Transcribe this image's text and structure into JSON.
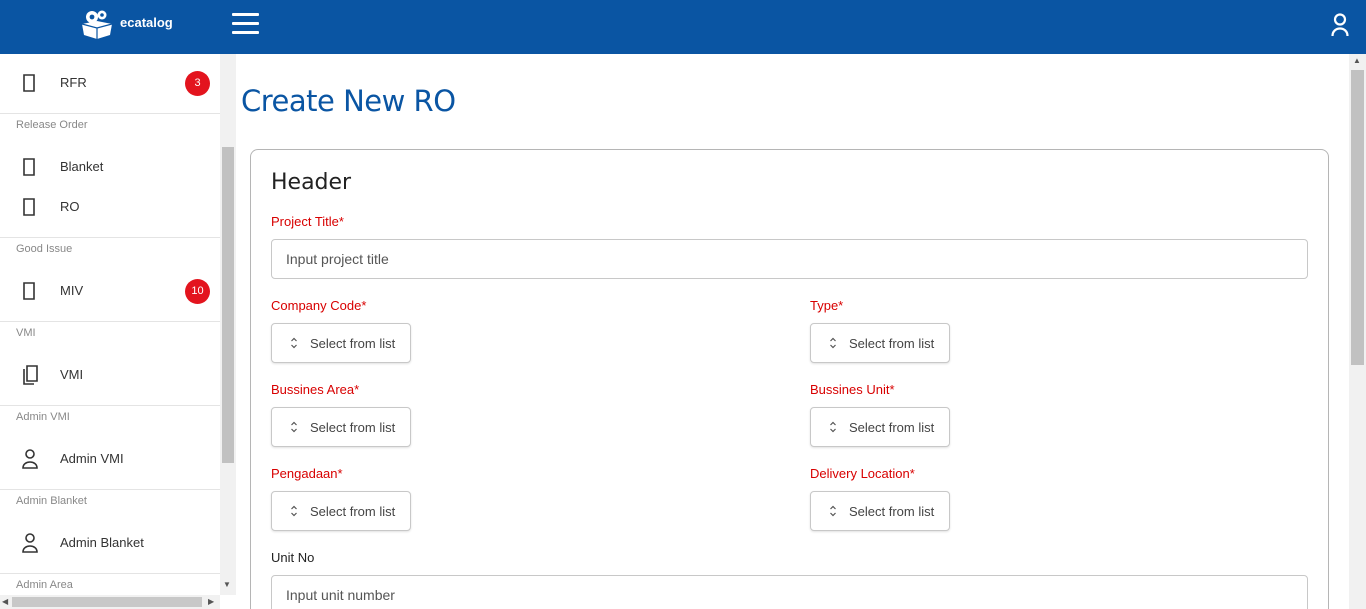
{
  "app": {
    "brand": "ecatalog"
  },
  "colors": {
    "topbar": "#0a55a3",
    "badge": "#e3141e",
    "required_label": "#d80000",
    "title": "#0a55a3"
  },
  "sidebar": {
    "items": [
      {
        "label": "RFR",
        "icon": "document-icon",
        "badge": "3"
      },
      {
        "label": "Blanket",
        "icon": "document-icon"
      },
      {
        "label": "RO",
        "icon": "document-icon"
      },
      {
        "label": "MIV",
        "icon": "document-icon",
        "badge": "10"
      },
      {
        "label": "VMI",
        "icon": "documents-icon"
      },
      {
        "label": "Admin VMI",
        "icon": "person-icon"
      },
      {
        "label": "Admin Blanket",
        "icon": "person-icon"
      }
    ],
    "sections": [
      "Release Order",
      "Good Issue",
      "VMI",
      "Admin VMI",
      "Admin Blanket",
      "Admin Area"
    ]
  },
  "page": {
    "title": "Create New RO"
  },
  "form": {
    "header_title": "Header",
    "project_title": {
      "label": "Project Title*",
      "placeholder": "Input project title"
    },
    "company_code": {
      "label": "Company Code*",
      "value": "Select from list"
    },
    "type": {
      "label": "Type*",
      "value": "Select from list"
    },
    "bussines_area": {
      "label": "Bussines Area*",
      "value": "Select from list"
    },
    "bussines_unit": {
      "label": "Bussines Unit*",
      "value": "Select from list"
    },
    "pengadaan": {
      "label": "Pengadaan*",
      "value": "Select from list"
    },
    "delivery_location": {
      "label": "Delivery Location*",
      "value": "Select from list"
    },
    "unit_no": {
      "label": "Unit No",
      "placeholder": "Input unit number"
    }
  }
}
